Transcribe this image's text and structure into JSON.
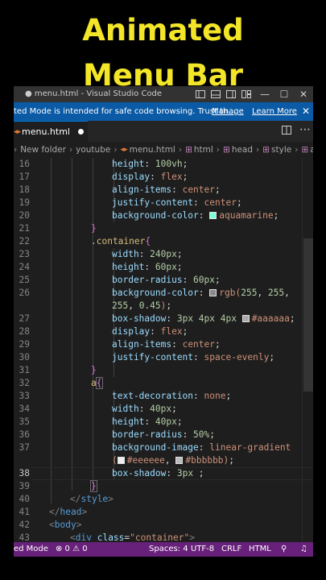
{
  "headline": {
    "line1": "Animated",
    "line2": "Menu Bar",
    "color": "#f3e528"
  },
  "window": {
    "title": "● menu.html - Visual Studio Code",
    "controls": {
      "minimize": "—",
      "maximize": "☐",
      "close": "✕"
    }
  },
  "banner": {
    "message": "ted Mode is intended for safe code browsing. Trust th...",
    "manage": "Manage",
    "learn_more": "Learn More",
    "close": "✕"
  },
  "tab": {
    "name": "menu.html"
  },
  "breadcrumb": {
    "items": [
      "New folder",
      "youtube",
      "menu.html",
      "html",
      "head",
      "style",
      "a"
    ]
  },
  "editor": {
    "lines": [
      {
        "n": "16",
        "t": "height: 100vh;"
      },
      {
        "n": "17",
        "t": "display: flex;"
      },
      {
        "n": "18",
        "t": "align-items: center;"
      },
      {
        "n": "19",
        "t": "justify-content: center;"
      },
      {
        "n": "20",
        "t": "background-color: aquamarine;"
      },
      {
        "n": "21",
        "t": "}"
      },
      {
        "n": "22",
        "t": ".container{"
      },
      {
        "n": "23",
        "t": "width: 240px;"
      },
      {
        "n": "24",
        "t": "height: 60px;"
      },
      {
        "n": "25",
        "t": "border-radius: 60px;"
      },
      {
        "n": "26",
        "t": "background-color: rgb(255, 255,"
      },
      {
        "n": "",
        "t": "255, 0.45);"
      },
      {
        "n": "27",
        "t": "box-shadow: 3px 4px 4px #aaaaaa;"
      },
      {
        "n": "28",
        "t": "display: flex;"
      },
      {
        "n": "29",
        "t": "align-items: center;"
      },
      {
        "n": "30",
        "t": "justify-content: space-evenly;"
      },
      {
        "n": "31",
        "t": "}"
      },
      {
        "n": "32",
        "t": "a{"
      },
      {
        "n": "33",
        "t": "text-decoration: none;"
      },
      {
        "n": "34",
        "t": "width: 40px;"
      },
      {
        "n": "35",
        "t": "height: 40px;"
      },
      {
        "n": "36",
        "t": "border-radius: 50%;"
      },
      {
        "n": "37",
        "t": "background-image: linear-gradient"
      },
      {
        "n": "",
        "t": "(#eeeeee, #bbbbbb);"
      },
      {
        "n": "38",
        "t": "box-shadow: 3px ;"
      },
      {
        "n": "39",
        "t": "}"
      },
      {
        "n": "40",
        "t": "</style>"
      },
      {
        "n": "41",
        "t": "</head>"
      },
      {
        "n": "42",
        "t": "<body>"
      },
      {
        "n": "43",
        "t": "<div class=\"container\">"
      }
    ],
    "swatches": {
      "aquamarine": "#7fffd4",
      "rgba": "#8a8a8a",
      "aaaaaa": "#aaaaaa",
      "eeeeee": "#eeeeee",
      "bbbbbb": "#bbbbbb"
    }
  },
  "statusbar": {
    "mode": "ed Mode",
    "problems": "⊗ 0 ⚠ 0",
    "spaces": "Spaces: 4",
    "encoding": "UTF-8",
    "eol": "CRLF",
    "language": "HTML"
  }
}
